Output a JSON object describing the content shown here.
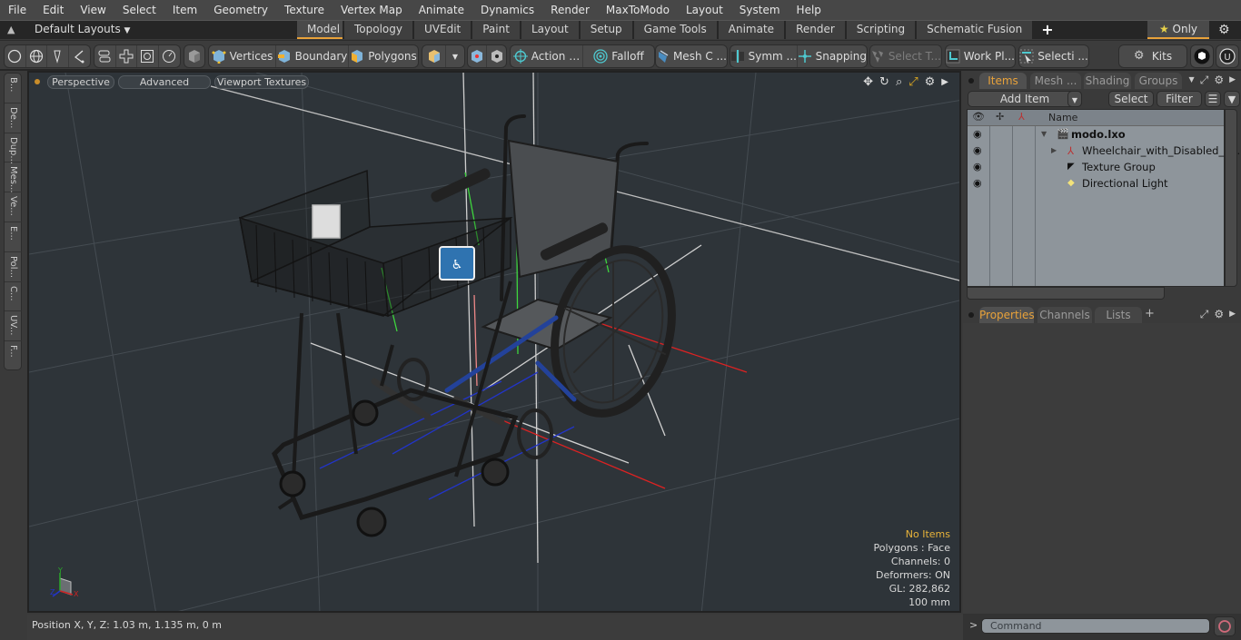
{
  "menu": [
    "File",
    "Edit",
    "View",
    "Select",
    "Item",
    "Geometry",
    "Texture",
    "Vertex Map",
    "Animate",
    "Dynamics",
    "Render",
    "MaxToModo",
    "Layout",
    "System",
    "Help"
  ],
  "layoutbar": {
    "layouts_label": "Default Layouts",
    "tabs": [
      "Model",
      "Topology",
      "UVEdit",
      "Paint",
      "Layout",
      "Setup",
      "Game Tools",
      "Animate",
      "Render",
      "Scripting",
      "Schematic Fusion"
    ],
    "active_tab": "Model",
    "add_tab": "+",
    "only_label": "Only"
  },
  "toolbar": {
    "vertices": "Vertices",
    "boundary": "Boundary",
    "polygons": "Polygons",
    "action": "Action",
    "falloff": "Falloff",
    "mesh_c": "Mesh C ...",
    "symm": "Symm ...",
    "snapping": "Snapping",
    "select_t": "Select T...",
    "work_pl": "Work Pl...",
    "selecti": "Selecti ...",
    "kits": "Kits"
  },
  "left_tabs": [
    "B...",
    "De...",
    "Dup...",
    "Mes...",
    "Ve...",
    "E...",
    "Pol...",
    "C...",
    "UV...",
    "F..."
  ],
  "viewport": {
    "view_mode": "Perspective",
    "shading": "Advanced",
    "textures": "Viewport Textures",
    "info": {
      "selection": "No Items",
      "polygons": "Polygons : Face",
      "channels": "Channels: 0",
      "deformers": "Deformers: ON",
      "gl": "GL: 282,862",
      "grid": "100 mm"
    }
  },
  "status": {
    "position": "Position X, Y, Z:   1.03 m, 1.135 m, 0 m"
  },
  "items_panel": {
    "tabs": [
      "Items",
      "Mesh ...",
      "Shading",
      "Groups"
    ],
    "active_tab": "Items",
    "add_item": "Add Item",
    "select": "Select",
    "filter": "Filter",
    "name_header": "Name",
    "tree": [
      {
        "label": "modo.lxo",
        "bold": true,
        "icon": "scene-icon"
      },
      {
        "label": "Wheelchair_with_Disabled_P ...",
        "icon": "mesh-locator-icon"
      },
      {
        "label": "Texture Group",
        "icon": "texture-group-icon"
      },
      {
        "label": "Directional Light",
        "icon": "light-icon"
      }
    ]
  },
  "properties_panel": {
    "tabs": [
      "Properties",
      "Channels",
      "Lists"
    ],
    "active_tab": "Properties",
    "add_tab": "+"
  },
  "command": {
    "prompt": ">",
    "placeholder": "Command"
  },
  "colors": {
    "accent": "#e8a23a",
    "viewport_bg": "#2e3439",
    "tree_bg": "#8e959b"
  }
}
